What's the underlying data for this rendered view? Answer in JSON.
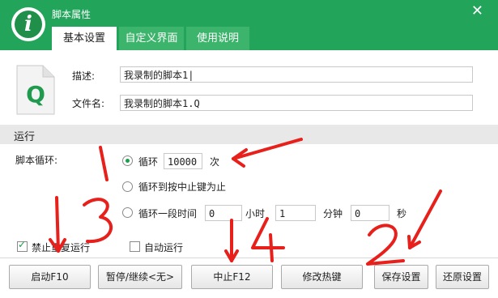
{
  "window": {
    "title": "脚本属性",
    "close_glyph": "✕",
    "logo_glyph": "i",
    "accent": "#22a45a"
  },
  "tabs": [
    {
      "label": "基本设置",
      "active": true
    },
    {
      "label": "自定义界面",
      "active": false
    },
    {
      "label": "使用说明",
      "active": false
    }
  ],
  "file": {
    "icon_letter": "Q"
  },
  "form": {
    "desc_label": "描述:",
    "desc_value": "我录制的脚本1|",
    "filename_label": "文件名:",
    "filename_value": "我录制的脚本1.Q"
  },
  "run": {
    "section_title": "运行",
    "loop_label": "脚本循环:",
    "opt_loop": "循环",
    "loop_count": "10000",
    "times_unit": "次",
    "opt_until_stop": "循环到按中止键为止",
    "opt_duration": "循环一段时间",
    "duration_values": {
      "days": "0",
      "hours": "1",
      "minutes": "0"
    },
    "hour_unit": "小时",
    "minute_unit": "分钟",
    "second_unit": "秒",
    "selected": "loop"
  },
  "options": {
    "no_repeat_label": "禁止重复运行",
    "no_repeat_checked": true,
    "auto_run_label": "自动运行",
    "auto_run_checked": false
  },
  "buttons": {
    "start": "启动F10",
    "pause": "暂停/继续<无>",
    "stop": "中止F12",
    "hotkey": "修改热键",
    "save": "保存设置",
    "restore": "还原设置"
  },
  "annotations": {
    "color": "#e8201c",
    "marks": [
      "1",
      "3",
      "4",
      "2"
    ]
  }
}
